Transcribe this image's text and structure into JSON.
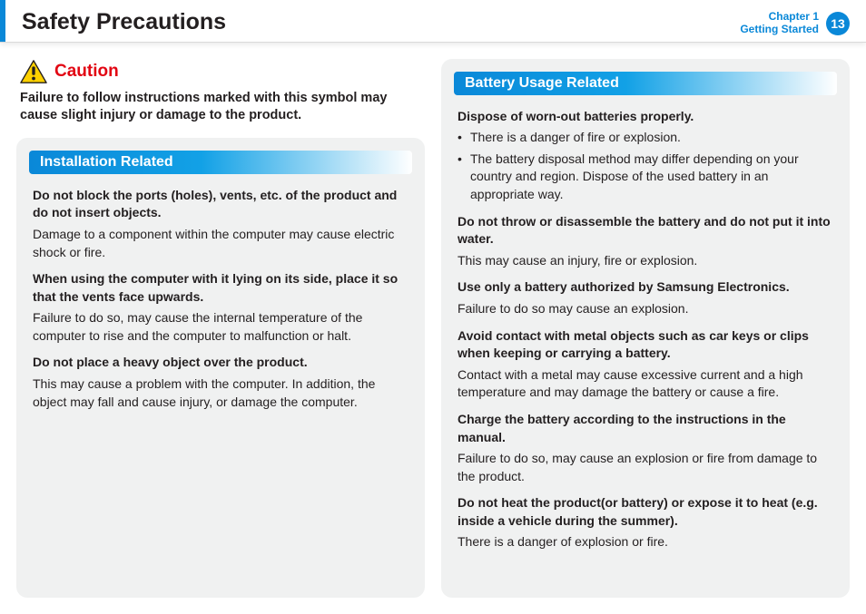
{
  "header": {
    "title": "Safety Precautions",
    "chapter_line1": "Chapter 1",
    "chapter_line2": "Getting Started",
    "page_number": "13"
  },
  "caution": {
    "label": "Caution",
    "description": "Failure to follow instructions marked with this symbol may cause slight injury or damage to the product."
  },
  "sections": {
    "installation": {
      "heading": "Installation Related",
      "items": [
        {
          "bold": "Do not block the ports (holes), vents, etc. of the product and do not insert objects.",
          "body": "Damage to a component within the computer may cause electric shock or fire."
        },
        {
          "bold": "When using the computer with it lying on its side, place it so that the vents face upwards.",
          "body": "Failure to do so, may cause the internal temperature of the computer to rise and the computer to malfunction or halt."
        },
        {
          "bold": "Do not place a heavy object over the product.",
          "body": "This may cause a problem with the computer. In addition, the object may fall and cause injury, or damage the computer."
        }
      ]
    },
    "battery": {
      "heading": "Battery Usage Related",
      "dispose_bold": "Dispose of worn-out batteries properly.",
      "dispose_bullets": [
        "There is a danger of fire or explosion.",
        "The battery disposal method may differ depending on your country and region. Dispose of the used battery in an appropriate way."
      ],
      "items": [
        {
          "bold": "Do not throw or disassemble the battery and do not put it into water.",
          "body": "This may cause an injury, fire or explosion."
        },
        {
          "bold": "Use only a battery authorized by Samsung Electronics.",
          "body": "Failure to do so may cause an explosion."
        },
        {
          "bold": "Avoid contact with metal objects such as car keys or clips when keeping or carrying a battery.",
          "body": "Contact with a metal may cause excessive current and a high temperature and may damage the battery or cause a fire."
        },
        {
          "bold": "Charge the battery according to the instructions in the manual.",
          "body": "Failure to do so, may cause an explosion or fire from damage to the product."
        },
        {
          "bold": "Do not heat the product(or battery) or expose it to heat (e.g. inside a vehicle during the summer).",
          "body": "There is a danger of explosion or fire."
        }
      ]
    }
  }
}
